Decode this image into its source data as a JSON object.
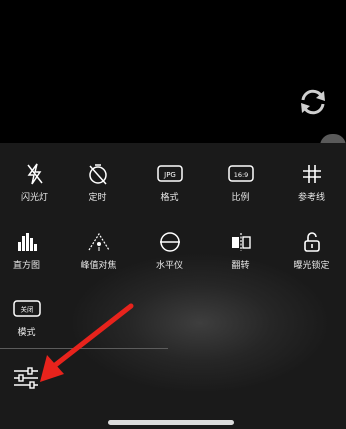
{
  "grid": {
    "items": [
      {
        "label": "闪光灯",
        "icon": "flash-off-icon"
      },
      {
        "label": "定时",
        "icon": "timer-off-icon"
      },
      {
        "label": "格式",
        "icon": "jpg-format-icon",
        "badge": "JPG"
      },
      {
        "label": "比例",
        "icon": "aspect-ratio-icon",
        "badge": "16:9"
      },
      {
        "label": "参考线",
        "icon": "grid-lines-icon"
      },
      {
        "label": "直方图",
        "icon": "histogram-icon"
      },
      {
        "label": "峰值对焦",
        "icon": "focus-peaking-icon"
      },
      {
        "label": "水平仪",
        "icon": "level-icon"
      },
      {
        "label": "翻转",
        "icon": "mirror-flip-icon"
      },
      {
        "label": "曝光锁定",
        "icon": "exposure-lock-icon"
      },
      {
        "label": "模式",
        "icon": "mode-off-icon",
        "badge": "关闭"
      }
    ]
  },
  "top": {
    "switch_icon": "switch-camera-icon"
  },
  "bottom": {
    "settings_icon": "settings-sliders-icon"
  },
  "annotation": {
    "arrow_color": "#e8231c"
  }
}
